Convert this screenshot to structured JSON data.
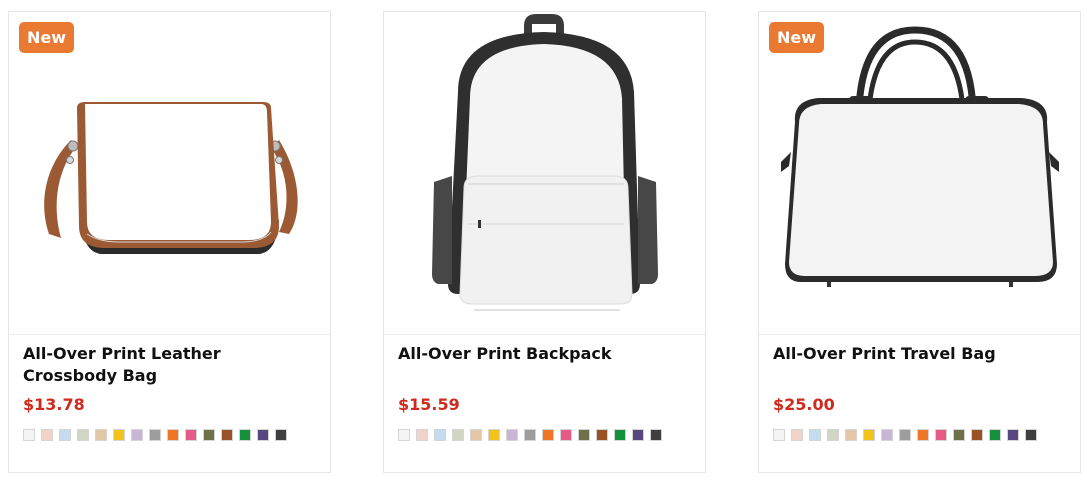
{
  "products": [
    {
      "badge": "New",
      "title": "All-Over Print Leather Crossbody Bag",
      "price": "$13.78",
      "image_icon": "crossbody-bag-icon"
    },
    {
      "badge": "",
      "title": "All-Over Print Backpack",
      "price": "$15.59",
      "image_icon": "backpack-icon"
    },
    {
      "badge": "New",
      "title": "All-Over Print Travel Bag",
      "price": "$25.00",
      "image_icon": "travel-bag-icon"
    }
  ],
  "swatch_colors": [
    "#f4f4f4",
    "#f2d3ca",
    "#c5dcf0",
    "#cfd7c4",
    "#e3c7a7",
    "#f2c21d",
    "#c9b5d6",
    "#9d9d9d",
    "#ef7626",
    "#e55b86",
    "#6e7047",
    "#9a5227",
    "#15903c",
    "#58467e",
    "#3f3f3f"
  ],
  "colors": {
    "badge": "#ea7a32",
    "price": "#cf2a1e",
    "border": "#e6e6e6"
  }
}
